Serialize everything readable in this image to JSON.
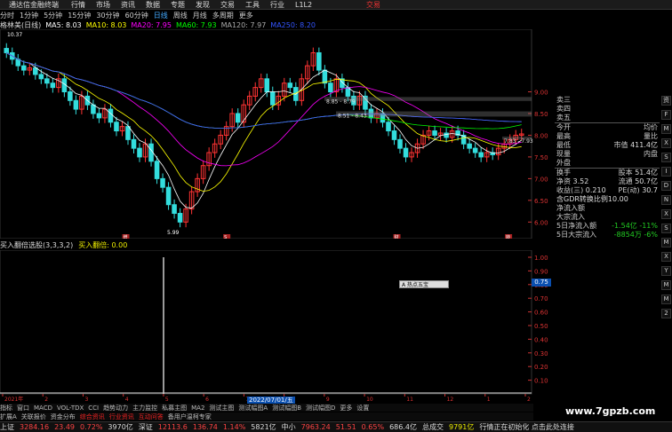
{
  "topmenu": {
    "app_title": "通达信金融终端",
    "items": [
      "行情",
      "市场",
      "资讯",
      "数据",
      "专题",
      "发现",
      "交易",
      "工具",
      "行业",
      "L1L2"
    ],
    "right_item": "交易"
  },
  "periodbar": {
    "items": [
      "分时",
      "1分钟",
      "5分钟",
      "15分钟",
      "30分钟",
      "60分钟",
      "日线",
      "周线",
      "月线",
      "多周期",
      "更多"
    ],
    "active": "日线"
  },
  "ma_legend": {
    "stock": "格林美(日线)",
    "items": [
      {
        "label": "MA5: 8.03",
        "color": "#ffffff"
      },
      {
        "label": "MA10: 8.03",
        "color": "#ffff00"
      },
      {
        "label": "MA20: 7.95",
        "color": "#ff00ff"
      },
      {
        "label": "MA60: 7.93",
        "color": "#00ff00"
      },
      {
        "label": "MA120: 7.97",
        "color": "#aaaaaa"
      },
      {
        "label": "MA250: 8.20",
        "color": "#3355ff"
      }
    ]
  },
  "price_axis": [
    "9.00",
    "8.50",
    "8.00",
    "7.50",
    "7.00",
    "6.50",
    "6.00"
  ],
  "annotations": {
    "high": "10.37",
    "low": "5.99",
    "range1": "8.85 - 8.79",
    "range2": "8.51 - 8.43",
    "range3": "7.83 - 7.93"
  },
  "event_markers": [
    "增",
    "S",
    "财",
    "转"
  ],
  "indicator": {
    "legend_name": "买入翻倍选股(3,3,3,2)",
    "legend_value": "买入翻倍: 0.00",
    "axis": [
      "1.00",
      "0.90",
      "0.80",
      "0.70",
      "0.60",
      "0.50",
      "0.40",
      "0.30",
      "0.20",
      "0.10"
    ],
    "current_value": "0.75",
    "popup": "A 热点五宝",
    "spike_value": 1.0
  },
  "date_axis": {
    "labels": [
      "2021年",
      "2",
      "3",
      "4",
      "5",
      "6",
      "7",
      "8",
      "9",
      "10",
      "11",
      "12",
      "1",
      "2"
    ],
    "badge": "2022/07/01/五"
  },
  "tabs_row1": [
    "指标",
    "窗口",
    "MACD",
    "VOL-TDX",
    "CCI",
    "趋势动力",
    "主力监控",
    "私募主图",
    "MA2",
    "测试主图",
    "测试幅图A",
    "测试幅图B",
    "测试幅图D",
    "更多",
    "设置"
  ],
  "tabs_row2": [
    "扩展A",
    "关联报价",
    "资金分布",
    "综合资讯",
    "行业资讯",
    "互动问答",
    "备用户温柯专家"
  ],
  "tabs_row2_highlight": [
    "综合资讯",
    "行业资讯",
    "互动问答"
  ],
  "right_panel": {
    "sell_levels": [
      "卖三",
      "卖四",
      "卖五"
    ],
    "quote": [
      [
        "今开",
        "",
        "均价",
        ""
      ],
      [
        "最高",
        "",
        "量比",
        ""
      ],
      [
        "最低",
        "",
        "市值",
        "411.4亿"
      ],
      [
        "现量",
        "",
        "内盘",
        ""
      ],
      [
        "外盘",
        "",
        "",
        ""
      ]
    ],
    "stats": [
      [
        "换手",
        "",
        "股本",
        "51.4亿"
      ],
      [
        "净资",
        "3.52",
        "流通",
        "50.7亿"
      ],
      [
        "收益(三)",
        "0.210",
        "PE(动)",
        "30.7"
      ]
    ],
    "gdr": "含GDR转换比例10.00",
    "flows": [
      {
        "label": "净流入额",
        "value": ""
      },
      {
        "label": "大宗流入",
        "value": ""
      }
    ],
    "flows5": [
      {
        "label": "5日净流入额",
        "value": "-1.54亿",
        "pct": "-11%"
      },
      {
        "label": "5日大宗流入",
        "value": "-8854万",
        "pct": "-6%"
      }
    ]
  },
  "sidebar_icons": [
    "资",
    "F",
    "M",
    "X",
    "S",
    "I",
    "D",
    "N",
    "X",
    "S",
    "M",
    "X",
    "Y",
    "M",
    "M",
    "2"
  ],
  "statusbar": {
    "items": [
      {
        "name": "上证",
        "value": "3284.16",
        "change": "23.49",
        "pct": "0.72%",
        "amount": "3970亿"
      },
      {
        "name": "深证",
        "value": "12113.6",
        "change": "136.74",
        "pct": "1.14%",
        "amount": "5821亿"
      },
      {
        "name": "中小",
        "value": "7963.24",
        "change": "51.51",
        "pct": "0.65%",
        "amount": "686.4亿"
      },
      {
        "name": "总成交",
        "value": "9791亿",
        "change": "",
        "pct": "",
        "amount": ""
      }
    ],
    "message": "行情正在初始化 点击此处连接"
  },
  "watermark": "www.7gpzb.com",
  "chart_data": {
    "type": "candlestick",
    "title": "格林美(日线)",
    "ylim": [
      5.7,
      10.4
    ],
    "series": [
      {
        "name": "K",
        "close": [
          9.9,
          9.75,
          9.6,
          9.5,
          9.55,
          9.4,
          9.3,
          9.2,
          9.1,
          9.3,
          9.0,
          8.8,
          8.6,
          8.9,
          8.7,
          8.5,
          8.4,
          8.6,
          8.3,
          8.1,
          8.2,
          7.9,
          7.7,
          7.5,
          7.8,
          7.4,
          7.0,
          6.8,
          6.4,
          6.2,
          6.0,
          6.3,
          6.7,
          7.0,
          7.3,
          7.6,
          7.8,
          8.0,
          8.2,
          8.5,
          8.3,
          8.7,
          8.9,
          9.1,
          9.3,
          9.0,
          8.7,
          8.9,
          9.2,
          9.1,
          8.8,
          9.3,
          9.6,
          9.9,
          9.5,
          9.2,
          9.0,
          9.3,
          9.1,
          8.9,
          8.7,
          8.9,
          8.6,
          8.4,
          8.5,
          8.3,
          8.1,
          7.9,
          7.7,
          7.5,
          7.6,
          7.8,
          8.0,
          8.1,
          8.0,
          8.05,
          7.95,
          8.1,
          8.0,
          7.8,
          7.7,
          7.6,
          7.5,
          7.6,
          7.55,
          7.7,
          7.8,
          7.9,
          8.0,
          8.03
        ]
      }
    ]
  }
}
